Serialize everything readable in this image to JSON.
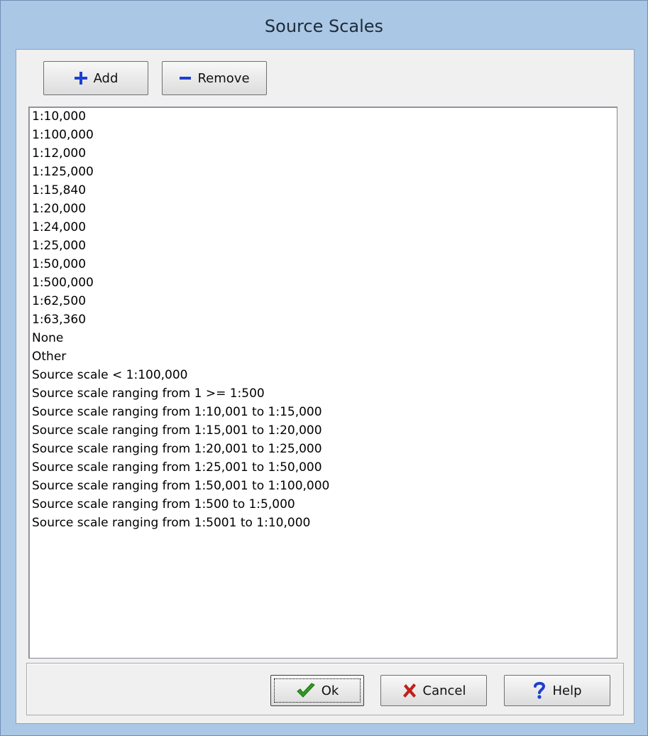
{
  "window": {
    "title": "Source Scales"
  },
  "toolbar": {
    "add_label": "Add",
    "remove_label": "Remove",
    "add_icon": "plus-icon",
    "remove_icon": "minus-icon"
  },
  "list": {
    "items": [
      "1:10,000",
      "1:100,000",
      "1:12,000",
      "1:125,000",
      "1:15,840",
      "1:20,000",
      "1:24,000",
      "1:25,000",
      "1:50,000",
      "1:500,000",
      "1:62,500",
      "1:63,360",
      "None",
      "Other",
      "Source scale < 1:100,000",
      "Source scale ranging from 1 >= 1:500",
      "Source scale ranging from 1:10,001 to 1:15,000",
      "Source scale ranging from 1:15,001 to 1:20,000",
      "Source scale ranging from 1:20,001 to 1:25,000",
      "Source scale ranging from 1:25,001 to 1:50,000",
      "Source scale ranging from 1:50,001 to 1:100,000",
      "Source scale ranging from 1:500 to 1:5,000",
      "Source scale ranging from 1:5001 to 1:10,000"
    ]
  },
  "footer": {
    "ok_label": "Ok",
    "cancel_label": "Cancel",
    "help_label": "Help",
    "ok_icon": "checkmark-icon",
    "cancel_icon": "x-icon",
    "help_icon": "question-mark-icon"
  },
  "colors": {
    "titlebar": "#aac7e6",
    "accent_blue": "#1f3fd1",
    "ok_green": "#2e9d22",
    "cancel_red": "#c0201a"
  }
}
